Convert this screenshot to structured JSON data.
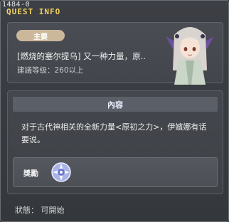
{
  "window": {
    "id_label": "1484-0",
    "title": "QUEST INFO"
  },
  "quest": {
    "badge": "主要",
    "title": "[燃烧的塞尔提乌] 又一种力量，原..",
    "level_text": "建議等级：260以上",
    "portrait_icon": "npc-portrait-icon"
  },
  "content": {
    "header": "內容",
    "description": "对于古代神相关的全新力量<原初之力>，伊嬪娜有话要说。",
    "reward_label": "獎勵",
    "reward_icon": "reward-item-icon"
  },
  "status": {
    "text": "狀態： 可開始"
  },
  "colors": {
    "title": "#f4d35c",
    "badge": "#cbb89a"
  }
}
